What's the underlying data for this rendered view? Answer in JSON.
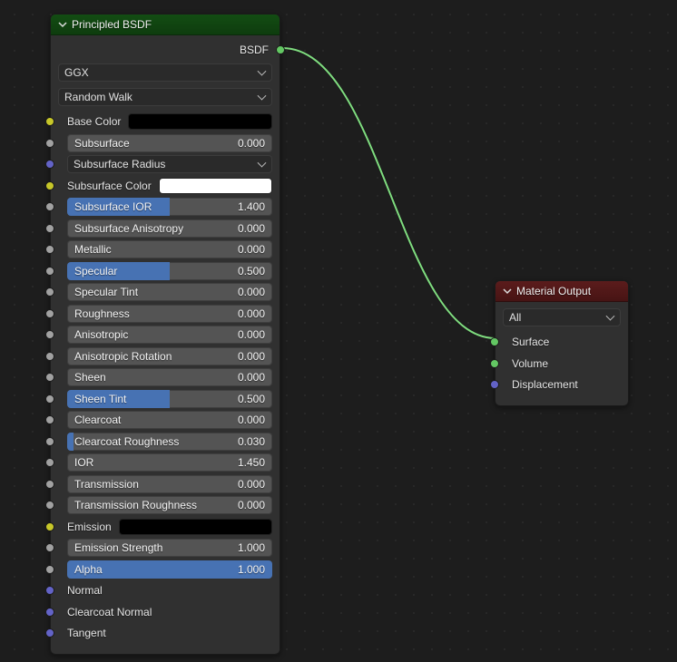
{
  "bsdf": {
    "title": "Principled BSDF",
    "output_label": "BSDF",
    "dist_dropdown": "GGX",
    "sss_dropdown": "Random Walk",
    "base_color_label": "Base Color",
    "base_color_swatch": "#000000",
    "sss_radius_label": "Subsurface Radius",
    "sss_color_label": "Subsurface Color",
    "sss_color_swatch": "#ffffff",
    "emission_label": "Emission",
    "emission_swatch": "#000000",
    "normal_label": "Normal",
    "clearcoat_normal_label": "Clearcoat Normal",
    "tangent_label": "Tangent",
    "sliders": {
      "subsurface": {
        "label": "Subsurface",
        "value": "0.000",
        "fill": 0
      },
      "sss_ior": {
        "label": "Subsurface IOR",
        "value": "1.400",
        "fill": 50
      },
      "sss_aniso": {
        "label": "Subsurface Anisotropy",
        "value": "0.000",
        "fill": 0
      },
      "metallic": {
        "label": "Metallic",
        "value": "0.000",
        "fill": 0
      },
      "specular": {
        "label": "Specular",
        "value": "0.500",
        "fill": 50
      },
      "specular_tint": {
        "label": "Specular Tint",
        "value": "0.000",
        "fill": 0
      },
      "roughness": {
        "label": "Roughness",
        "value": "0.000",
        "fill": 0
      },
      "anisotropic": {
        "label": "Anisotropic",
        "value": "0.000",
        "fill": 0
      },
      "aniso_rot": {
        "label": "Anisotropic Rotation",
        "value": "0.000",
        "fill": 0
      },
      "sheen": {
        "label": "Sheen",
        "value": "0.000",
        "fill": 0
      },
      "sheen_tint": {
        "label": "Sheen Tint",
        "value": "0.500",
        "fill": 50
      },
      "clearcoat": {
        "label": "Clearcoat",
        "value": "0.000",
        "fill": 0
      },
      "clearcoat_rough": {
        "label": "Clearcoat Roughness",
        "value": "0.030",
        "fill": 3
      },
      "ior": {
        "label": "IOR",
        "value": "1.450",
        "fill": 0
      },
      "transmission": {
        "label": "Transmission",
        "value": "0.000",
        "fill": 0
      },
      "transmission_rough": {
        "label": "Transmission Roughness",
        "value": "0.000",
        "fill": 0
      },
      "emission_strength": {
        "label": "Emission Strength",
        "value": "1.000",
        "fill": 0
      },
      "alpha": {
        "label": "Alpha",
        "value": "1.000",
        "fill": 100
      }
    }
  },
  "material_output": {
    "title": "Material Output",
    "target_dropdown": "All",
    "surface_label": "Surface",
    "volume_label": "Volume",
    "displacement_label": "Displacement"
  }
}
